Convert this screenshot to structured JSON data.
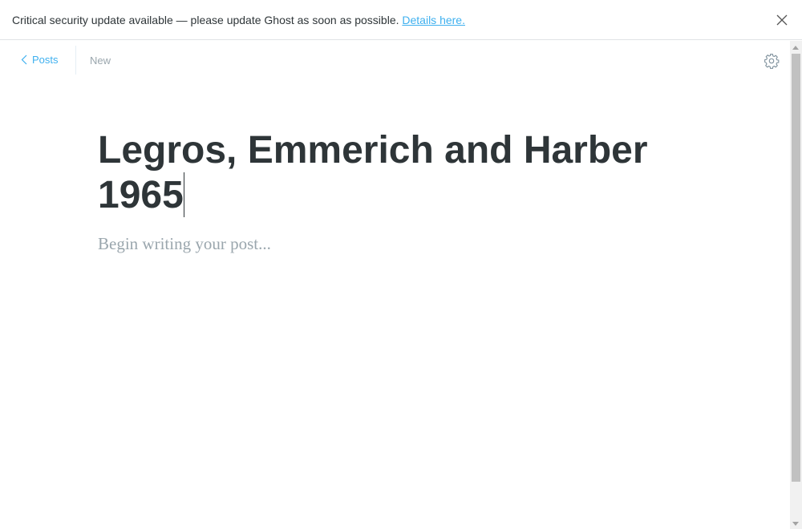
{
  "banner": {
    "message": "Critical security update available — please update Ghost as soon as possible.",
    "link": "Details here."
  },
  "nav": {
    "back_label": "Posts",
    "status": "New"
  },
  "editor": {
    "title": "Legros, Emmerich and Harber 1965",
    "body_placeholder": "Begin writing your post..."
  },
  "colors": {
    "accent": "#3eb0ef",
    "text": "#2e3538",
    "muted": "#9aa6ad"
  }
}
